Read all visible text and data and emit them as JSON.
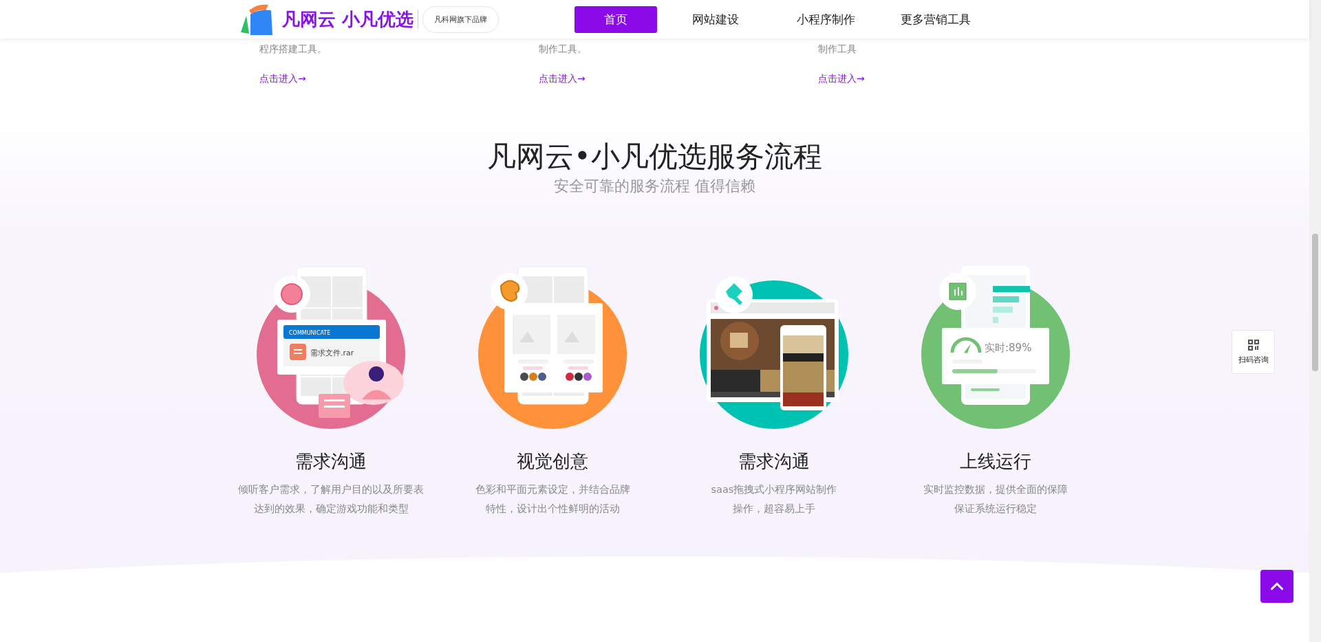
{
  "header": {
    "brand": "凡网云 小凡优选",
    "badge": "凡科网旗下品牌",
    "nav": [
      {
        "label": "首页",
        "selected": true
      },
      {
        "label": "网站建设",
        "selected": false
      },
      {
        "label": "小程序制作",
        "selected": false
      },
      {
        "label": "更多营销工具",
        "selected": false
      }
    ]
  },
  "features": [
    {
      "description": "程序搭建工具。",
      "link": "点击进入→"
    },
    {
      "description": "制作工具。",
      "link": "点击进入→"
    },
    {
      "description": "制作工具",
      "link": "点击进入→"
    }
  ],
  "process": {
    "title": "凡网云•小凡优选服务流程",
    "subtitle": "安全可靠的服务流程 值得信赖",
    "steps": [
      {
        "kind": "communicate",
        "color": "#e36d91",
        "labels": [
          "COMMUNICATE",
          "需求文件.rar"
        ],
        "title": "需求沟通",
        "description": [
          "倾听客户需求，了解用户目的以及所要表",
          "达到的效果，确定游戏功能和类型"
        ]
      },
      {
        "kind": "design",
        "color": "#fd923a",
        "title": "视觉创意",
        "description": [
          "色彩和平面元素设定，并结合品牌",
          "特性，设计出个性鲜明的活动"
        ]
      },
      {
        "kind": "build",
        "color": "#00c2b3",
        "title": "需求沟通",
        "description": [
          "saas拖拽式小程序网站制作",
          "操作，超容易上手"
        ]
      },
      {
        "kind": "launch",
        "color": "#72c074",
        "labels": [
          "实时:89%"
        ],
        "title": "上线运行",
        "description": [
          "实时监控数据，提供全面的保障",
          "保证系统运行稳定"
        ]
      }
    ]
  },
  "qr_widget": {
    "label": "扫码咨询"
  }
}
